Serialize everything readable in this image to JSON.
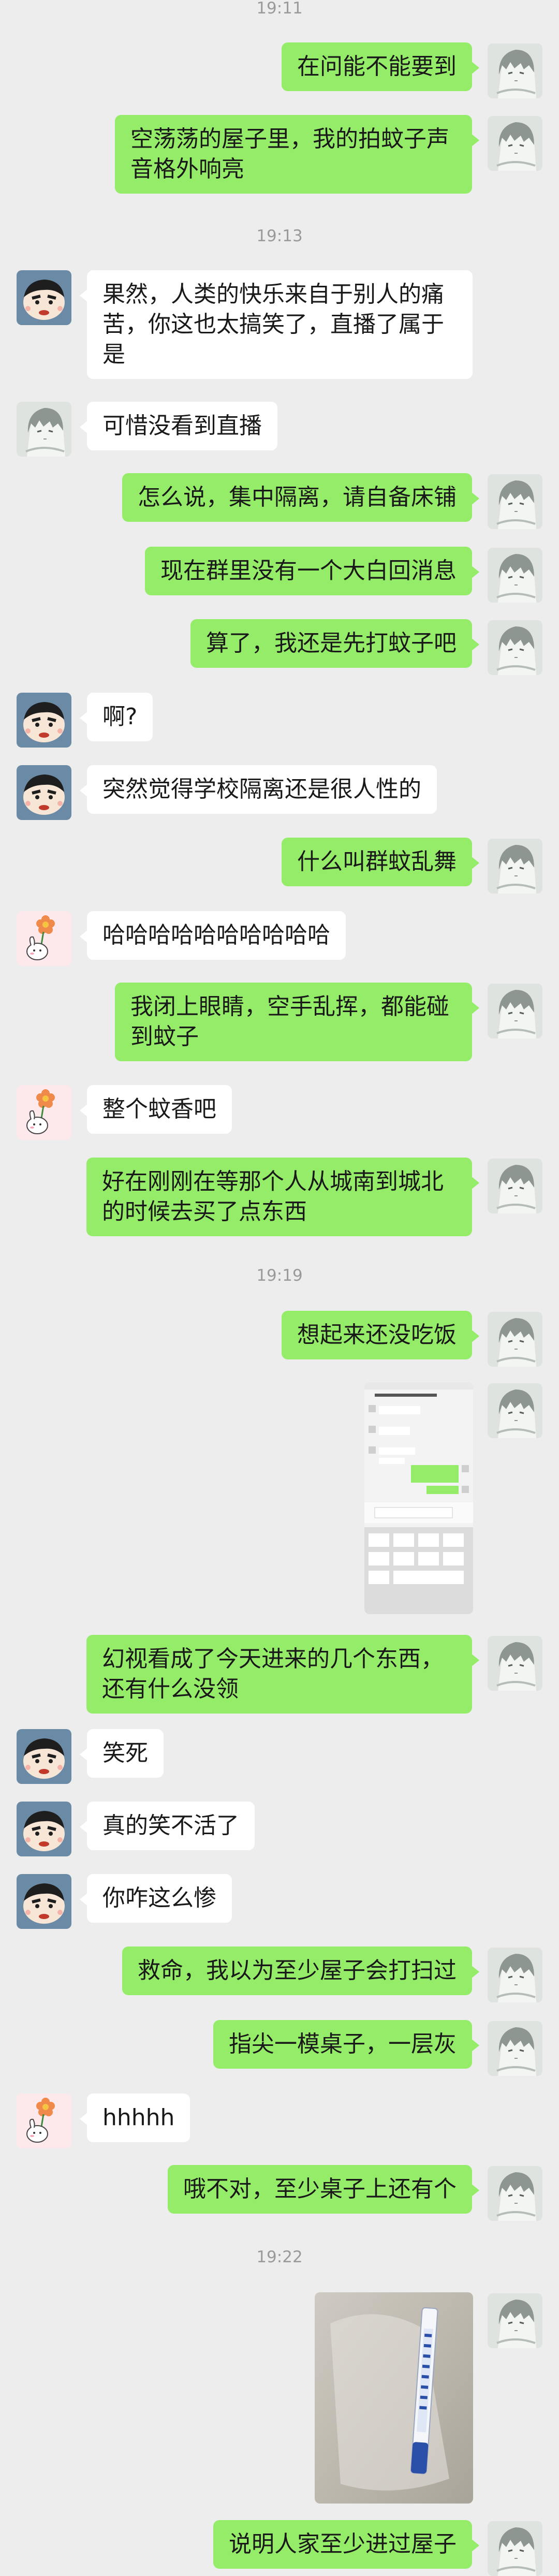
{
  "timestamps": [
    "19:11",
    "19:13",
    "19:19",
    "19:22"
  ],
  "messages": [
    {
      "side": "me",
      "text": "在问能不能要到"
    },
    {
      "side": "me",
      "text": "空荡荡的屋子里，我的拍蚊子声音格外响亮"
    },
    {
      "side": "other",
      "avatar": "shinchan",
      "text": "果然，人类的快乐来自于别人的痛苦，你这也太搞笑了，直播了属于是"
    },
    {
      "side": "other",
      "avatar": "anime-boy",
      "text": "可惜没看到直播"
    },
    {
      "side": "me",
      "text": "怎么说，集中隔离，请自备床铺"
    },
    {
      "side": "me",
      "text": "现在群里没有一个大白回消息"
    },
    {
      "side": "me",
      "text": "算了，我还是先打蚊子吧"
    },
    {
      "side": "other",
      "avatar": "shinchan",
      "text": "啊?"
    },
    {
      "side": "other",
      "avatar": "shinchan",
      "text": "突然觉得学校隔离还是很人性的"
    },
    {
      "side": "me",
      "text": "什么叫群蚊乱舞"
    },
    {
      "side": "other",
      "avatar": "flower-bunny",
      "text": "哈哈哈哈哈哈哈哈哈哈"
    },
    {
      "side": "me",
      "text": "我闭上眼睛，空手乱挥，都能碰到蚊子"
    },
    {
      "side": "other",
      "avatar": "flower-bunny",
      "text": "整个蚊香吧"
    },
    {
      "side": "me",
      "text": "好在刚刚在等那个人从城南到城北的时候去买了点东西"
    },
    {
      "side": "me",
      "text": "想起来还没吃饭"
    },
    {
      "side": "me",
      "type": "image",
      "image": "chat-screenshot"
    },
    {
      "side": "me",
      "text": "幻视看成了今天进来的几个东西，还有什么没领"
    },
    {
      "side": "other",
      "avatar": "shinchan",
      "text": "笑死"
    },
    {
      "side": "other",
      "avatar": "shinchan",
      "text": "真的笑不活了"
    },
    {
      "side": "other",
      "avatar": "shinchan",
      "text": "你咋这么惨"
    },
    {
      "side": "me",
      "text": "救命，我以为至少屋子会打扫过"
    },
    {
      "side": "me",
      "text": "指尖一模桌子，一层灰"
    },
    {
      "side": "other",
      "avatar": "flower-bunny",
      "text": "hhhhh"
    },
    {
      "side": "me",
      "text": "哦不对，至少桌子上还有个"
    },
    {
      "side": "me",
      "type": "image",
      "image": "thermometer-photo"
    },
    {
      "side": "me",
      "text": "说明人家至少进过屋子"
    }
  ],
  "colors": {
    "me_bubble": "#95ec69",
    "other_bubble": "#ffffff",
    "background": "#ededed",
    "timestamp": "#9a9a9a"
  }
}
